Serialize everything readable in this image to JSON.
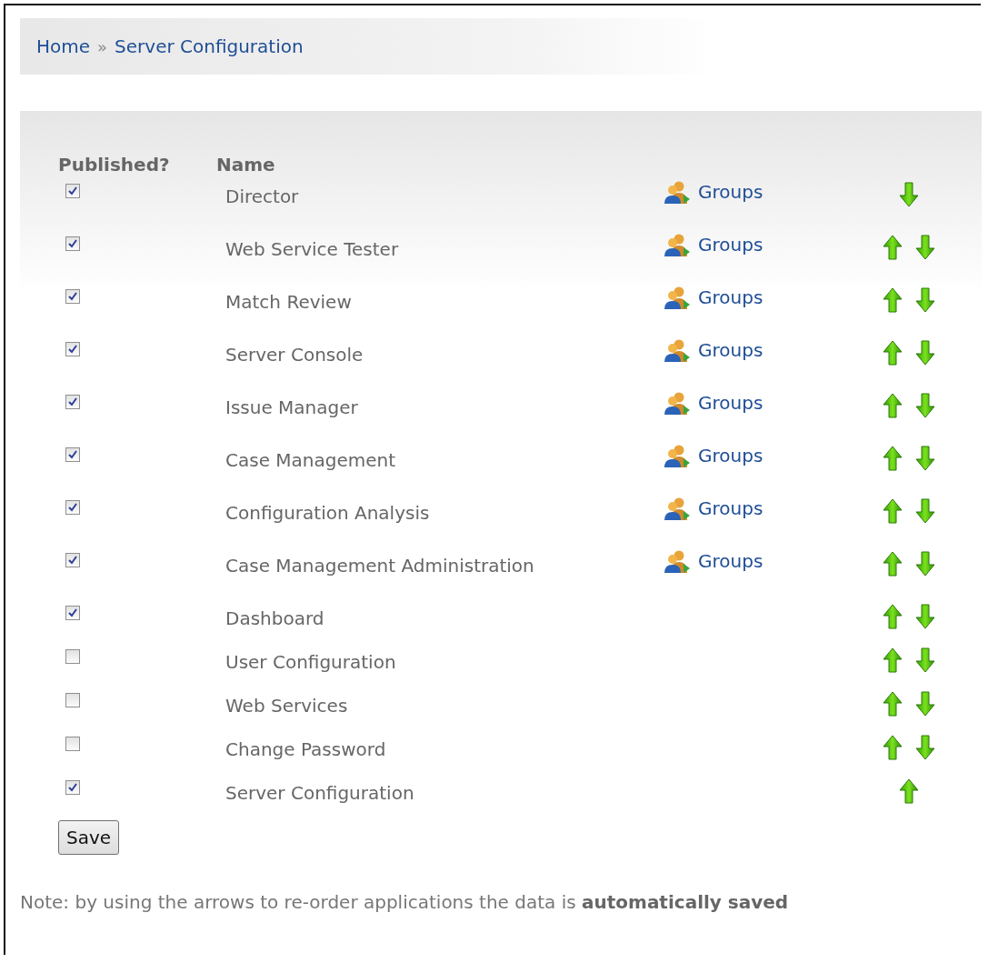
{
  "breadcrumb": {
    "items": [
      {
        "label": "Home"
      },
      {
        "label": "Server Configuration"
      }
    ],
    "separator": "»"
  },
  "table": {
    "columns": [
      "Published?",
      "Name"
    ],
    "rows": [
      {
        "published": true,
        "name": "Director",
        "groups_link": "Groups",
        "move_up": false,
        "move_down": true
      },
      {
        "published": true,
        "name": "Web Service Tester",
        "groups_link": "Groups",
        "move_up": true,
        "move_down": true
      },
      {
        "published": true,
        "name": "Match Review",
        "groups_link": "Groups",
        "move_up": true,
        "move_down": true
      },
      {
        "published": true,
        "name": "Server Console",
        "groups_link": "Groups",
        "move_up": true,
        "move_down": true
      },
      {
        "published": true,
        "name": "Issue Manager",
        "groups_link": "Groups",
        "move_up": true,
        "move_down": true
      },
      {
        "published": true,
        "name": "Case Management",
        "groups_link": "Groups",
        "move_up": true,
        "move_down": true
      },
      {
        "published": true,
        "name": "Configuration Analysis",
        "groups_link": "Groups",
        "move_up": true,
        "move_down": true
      },
      {
        "published": true,
        "name": "Case Management Administration",
        "groups_link": "Groups",
        "move_up": true,
        "move_down": true
      },
      {
        "published": true,
        "name": "Dashboard",
        "move_up": true,
        "move_down": true
      },
      {
        "published": false,
        "name": "User Configuration",
        "move_up": true,
        "move_down": true
      },
      {
        "published": false,
        "name": "Web Services",
        "move_up": true,
        "move_down": true
      },
      {
        "published": false,
        "name": "Change Password",
        "move_up": true,
        "move_down": true
      },
      {
        "published": true,
        "name": "Server Configuration",
        "move_up": true,
        "move_down": false
      }
    ]
  },
  "save_button": "Save",
  "note": "Note: by using the arrows to re-order applications the data is **automatically saved**"
}
